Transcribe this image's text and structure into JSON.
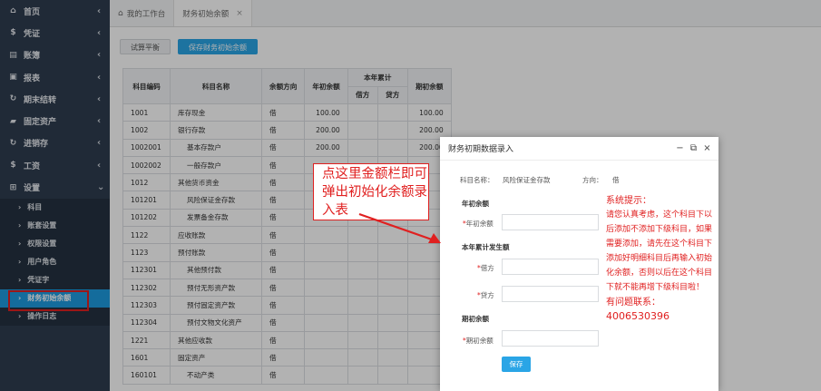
{
  "sidebar": {
    "items": [
      {
        "label": "首页",
        "icon": "home-icon",
        "glyph": "⌂"
      },
      {
        "label": "凭证",
        "icon": "dollar-icon",
        "glyph": "$"
      },
      {
        "label": "账簿",
        "icon": "book-icon",
        "glyph": "▤"
      },
      {
        "label": "报表",
        "icon": "report-icon",
        "glyph": "▣"
      },
      {
        "label": "期末结转",
        "icon": "refresh-icon",
        "glyph": "↻"
      },
      {
        "label": "固定资产",
        "icon": "asset-icon",
        "glyph": "▰"
      },
      {
        "label": "进销存",
        "icon": "cycle-icon",
        "glyph": "↻"
      },
      {
        "label": "工资",
        "icon": "dollar-icon",
        "glyph": "$"
      },
      {
        "label": "设置",
        "icon": "grid-icon",
        "glyph": "⊞"
      }
    ],
    "sub_items": [
      "科目",
      "账套设置",
      "权限设置",
      "用户角色",
      "凭证字",
      "财务初始余额",
      "操作日志"
    ]
  },
  "tabs": [
    {
      "label": "我的工作台"
    },
    {
      "label": "财务初始余额"
    }
  ],
  "toolbar": {
    "trial_balance": "试算平衡",
    "save": "保存财务初始余额"
  },
  "table": {
    "headers": {
      "code": "科目编码",
      "name": "科目名称",
      "direction": "余额方向",
      "opening": "年初余额",
      "year_total": "本年累计",
      "debit": "借方",
      "credit": "贷方",
      "ending": "期初余额"
    },
    "rows": [
      {
        "code": "1001",
        "name": "库存现金",
        "dir": "借",
        "opening": "100.00",
        "ending": "100.00",
        "indent": false
      },
      {
        "code": "1002",
        "name": "银行存款",
        "dir": "借",
        "opening": "200.00",
        "ending": "200.00",
        "indent": false
      },
      {
        "code": "1002001",
        "name": "基本存款户",
        "dir": "借",
        "opening": "200.00",
        "ending": "200.00",
        "indent": true
      },
      {
        "code": "1002002",
        "name": "一般存款户",
        "dir": "借",
        "opening": "",
        "ending": "",
        "indent": true
      },
      {
        "code": "1012",
        "name": "其他货币资金",
        "dir": "借",
        "opening": "",
        "ending": "",
        "indent": false
      },
      {
        "code": "101201",
        "name": "风险保证金存款",
        "dir": "借",
        "opening": "",
        "ending": "",
        "indent": true
      },
      {
        "code": "101202",
        "name": "发票备金存款",
        "dir": "借",
        "opening": "",
        "ending": "",
        "indent": true
      },
      {
        "code": "1122",
        "name": "应收账款",
        "dir": "借",
        "opening": "",
        "ending": "",
        "indent": false
      },
      {
        "code": "1123",
        "name": "预付账款",
        "dir": "借",
        "opening": "",
        "ending": "",
        "indent": false
      },
      {
        "code": "112301",
        "name": "其他预付款",
        "dir": "借",
        "opening": "",
        "ending": "",
        "indent": true
      },
      {
        "code": "112302",
        "name": "预付无形资产款",
        "dir": "借",
        "opening": "",
        "ending": "",
        "indent": true
      },
      {
        "code": "112303",
        "name": "预付固定资产款",
        "dir": "借",
        "opening": "",
        "ending": "",
        "indent": true
      },
      {
        "code": "112304",
        "name": "预付文物文化资产",
        "dir": "借",
        "opening": "",
        "ending": "",
        "indent": true
      },
      {
        "code": "1221",
        "name": "其他应收款",
        "dir": "借",
        "opening": "",
        "ending": "",
        "indent": false
      },
      {
        "code": "1601",
        "name": "固定资产",
        "dir": "借",
        "opening": "",
        "ending": "",
        "indent": false
      },
      {
        "code": "160101",
        "name": "不动产类",
        "dir": "借",
        "opening": "",
        "ending": "",
        "indent": true
      }
    ]
  },
  "modal": {
    "title": "财务初期数据录入",
    "subject_label": "科目名称：",
    "subject_value": "风险保证金存款",
    "direction_label": "方向：",
    "direction_value": "借",
    "section_opening": "年初余额",
    "opening_label": "年初余额",
    "section_year": "本年累计发生额",
    "debit_label": "借方",
    "credit_label": "贷方",
    "section_ending": "期初余额",
    "ending_label": "期初余额",
    "save_label": "保存",
    "tip_title": "系统提示：",
    "tip_body": "请您认真考虑，这个科目下以后添加不添加下级科目，如果需要添加，请先在这个科目下添加好明细科目后再输入初始化余额，否则以后在这个科目下就不能再增下级科目啦！",
    "contact_label": "有问题联系：",
    "contact_phone": "4006530396"
  },
  "annotation": {
    "text": "点这里金额栏即可弹出初始化余额录入表"
  },
  "colors": {
    "sidebar_bg": "#2f3d4f",
    "accent": "#1d9be0",
    "annotation": "#e02020"
  }
}
